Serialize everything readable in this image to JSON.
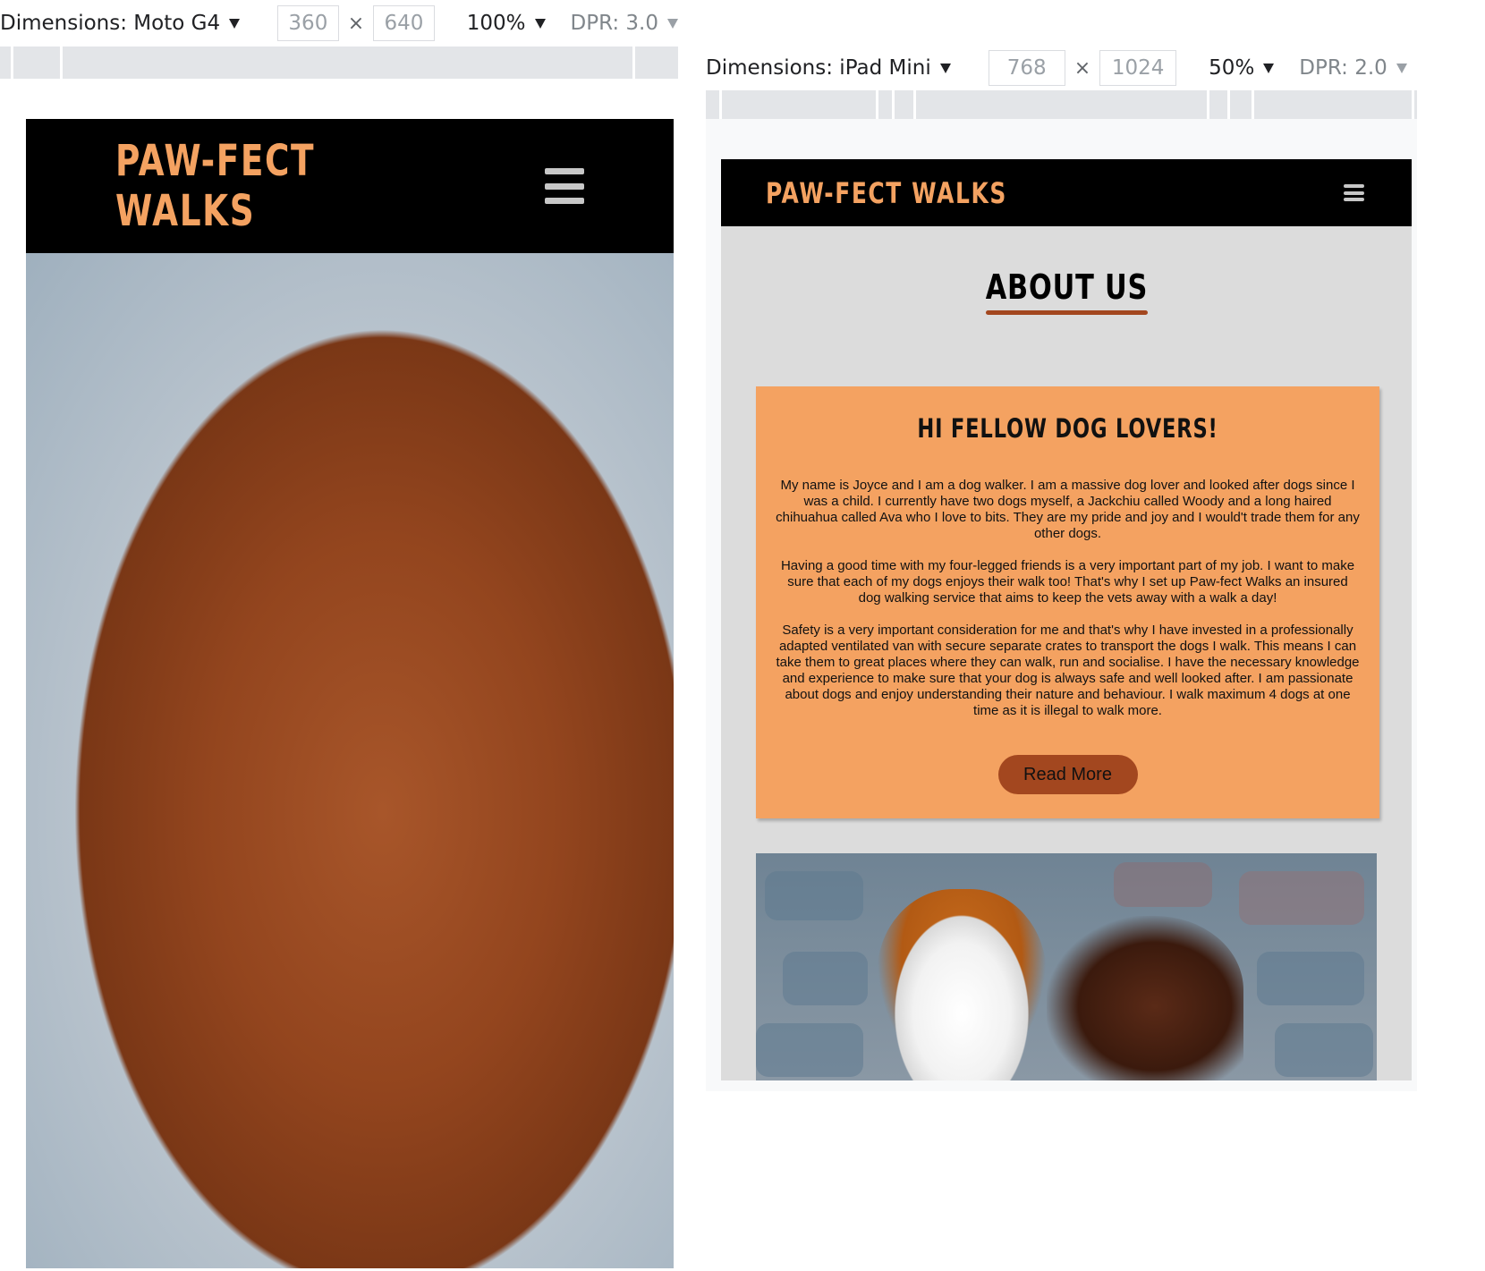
{
  "left_toolbar": {
    "device_label": "Dimensions: Moto G4",
    "width": "360",
    "separator": "×",
    "height": "640",
    "zoom": "100%",
    "dpr": "DPR: 3.0"
  },
  "right_toolbar": {
    "device_label": "Dimensions: iPad Mini",
    "width": "768",
    "separator": "×",
    "height": "1024",
    "zoom": "50%",
    "dpr": "DPR: 2.0"
  },
  "site": {
    "brand": "PAW-FECT WALKS",
    "brand_color": "#f4a261",
    "accent_color": "#a3471f",
    "menu_icon": "hamburger-icon"
  },
  "about": {
    "title": "ABOUT US",
    "card_title": "HI FELLOW DOG LOVERS!",
    "paragraphs": [
      "My name is Joyce and I am a dog walker. I am a massive dog lover and looked after dogs since I was a child. I currently have two dogs myself, a Jackchiu called Woody and a long haired chihuahua called Ava who I love to bits. They are my pride and joy and I would't trade them for any other dogs.",
      "Having a good time with my four-legged friends is a very important part of my job. I want to make sure that each of my dogs enjoys their walk too! That's why I set up Paw-fect Walks an insured dog walking service that aims to keep the vets away with a walk a day!",
      "Safety is a very important consideration for me and that's why I have invested in a professionally adapted ventilated van with secure separate crates to transport the dogs I walk. This means I can take them to great places where they can walk, run and socialise. I have the necessary knowledge and experience to make sure that your dog is always safe and well looked after. I am passionate about dogs and enjoy understanding their nature and behaviour. I walk maximum 4 dogs at one time as it is illegal to walk more."
    ],
    "button_label": "Read More"
  }
}
